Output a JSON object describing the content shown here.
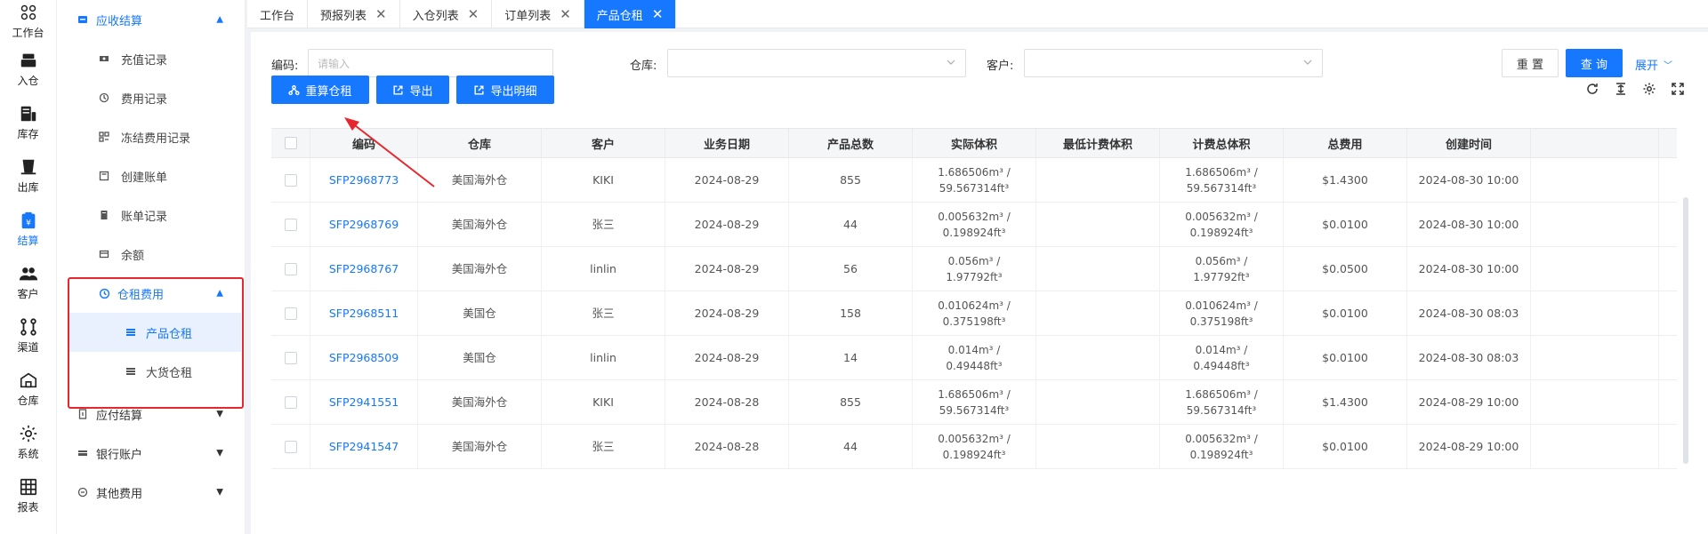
{
  "rail": [
    {
      "label": "工作台",
      "icon": "workbench-icon"
    },
    {
      "label": "入仓",
      "icon": "inbound-icon"
    },
    {
      "label": "库存",
      "icon": "inventory-icon"
    },
    {
      "label": "出库",
      "icon": "outbound-icon"
    },
    {
      "label": "结算",
      "icon": "settlement-icon",
      "active": true
    },
    {
      "label": "客户",
      "icon": "customer-icon"
    },
    {
      "label": "渠道",
      "icon": "channel-icon"
    },
    {
      "label": "仓库",
      "icon": "warehouse-icon"
    },
    {
      "label": "系统",
      "icon": "gear-icon"
    },
    {
      "label": "报表",
      "icon": "report-icon"
    }
  ],
  "menu": {
    "receivable": "应收结算",
    "receivable_items": [
      "充值记录",
      "费用记录",
      "冻结费用记录",
      "创建账单",
      "账单记录",
      "余额"
    ],
    "storage_fee": "仓租费用",
    "storage_items": [
      "产品仓租",
      "大货仓租"
    ],
    "payable": "应付结算",
    "bank": "银行账户",
    "other": "其他费用"
  },
  "tabs": [
    "工作台",
    "预报列表",
    "入仓列表",
    "订单列表",
    "产品仓租"
  ],
  "filters": {
    "code_label": "编码:",
    "code_placeholder": "请输入",
    "warehouse_label": "仓库:",
    "customer_label": "客户:",
    "reset": "重 置",
    "query": "查 询",
    "expand": "展开"
  },
  "actions": {
    "recalc": "重算仓租",
    "export": "导出",
    "export_detail": "导出明细"
  },
  "table": {
    "headers": [
      "编码",
      "仓库",
      "客户",
      "业务日期",
      "产品总数",
      "实际体积",
      "最低计费体积",
      "计费总体积",
      "总费用",
      "创建时间"
    ],
    "rows": [
      {
        "code": "SFP2968773",
        "warehouse": "美国海外仓",
        "customer": "KIKI",
        "date": "2024-08-29",
        "qty": "855",
        "vol1": "1.686506m³ /",
        "vol2": "59.567314ft³",
        "min": "",
        "bill1": "1.686506m³ /",
        "bill2": "59.567314ft³",
        "fee": "$1.4300",
        "created": "2024-08-30 10:00"
      },
      {
        "code": "SFP2968769",
        "warehouse": "美国海外仓",
        "customer": "张三",
        "date": "2024-08-29",
        "qty": "44",
        "vol1": "0.005632m³ /",
        "vol2": "0.198924ft³",
        "min": "",
        "bill1": "0.005632m³ /",
        "bill2": "0.198924ft³",
        "fee": "$0.0100",
        "created": "2024-08-30 10:00"
      },
      {
        "code": "SFP2968767",
        "warehouse": "美国海外仓",
        "customer": "linlin",
        "date": "2024-08-29",
        "qty": "56",
        "vol1": "0.056m³ /",
        "vol2": "1.97792ft³",
        "min": "",
        "bill1": "0.056m³ /",
        "bill2": "1.97792ft³",
        "fee": "$0.0500",
        "created": "2024-08-30 10:00"
      },
      {
        "code": "SFP2968511",
        "warehouse": "美国仓",
        "customer": "张三",
        "date": "2024-08-29",
        "qty": "158",
        "vol1": "0.010624m³ /",
        "vol2": "0.375198ft³",
        "min": "",
        "bill1": "0.010624m³ /",
        "bill2": "0.375198ft³",
        "fee": "$0.0100",
        "created": "2024-08-30 08:03"
      },
      {
        "code": "SFP2968509",
        "warehouse": "美国仓",
        "customer": "linlin",
        "date": "2024-08-29",
        "qty": "14",
        "vol1": "0.014m³ /",
        "vol2": "0.49448ft³",
        "min": "",
        "bill1": "0.014m³ /",
        "bill2": "0.49448ft³",
        "fee": "$0.0100",
        "created": "2024-08-30 08:03"
      },
      {
        "code": "SFP2941551",
        "warehouse": "美国海外仓",
        "customer": "KIKI",
        "date": "2024-08-28",
        "qty": "855",
        "vol1": "1.686506m³ /",
        "vol2": "59.567314ft³",
        "min": "",
        "bill1": "1.686506m³ /",
        "bill2": "59.567314ft³",
        "fee": "$1.4300",
        "created": "2024-08-29 10:00"
      },
      {
        "code": "SFP2941547",
        "warehouse": "美国海外仓",
        "customer": "张三",
        "date": "2024-08-28",
        "qty": "44",
        "vol1": "0.005632m³ /",
        "vol2": "0.198924ft³",
        "min": "",
        "bill1": "0.005632m³ /",
        "bill2": "0.198924ft³",
        "fee": "$0.0100",
        "created": "2024-08-29 10:00"
      }
    ]
  },
  "colors": {
    "accent": "#1677ff",
    "highlight_box": "#e8262e"
  }
}
